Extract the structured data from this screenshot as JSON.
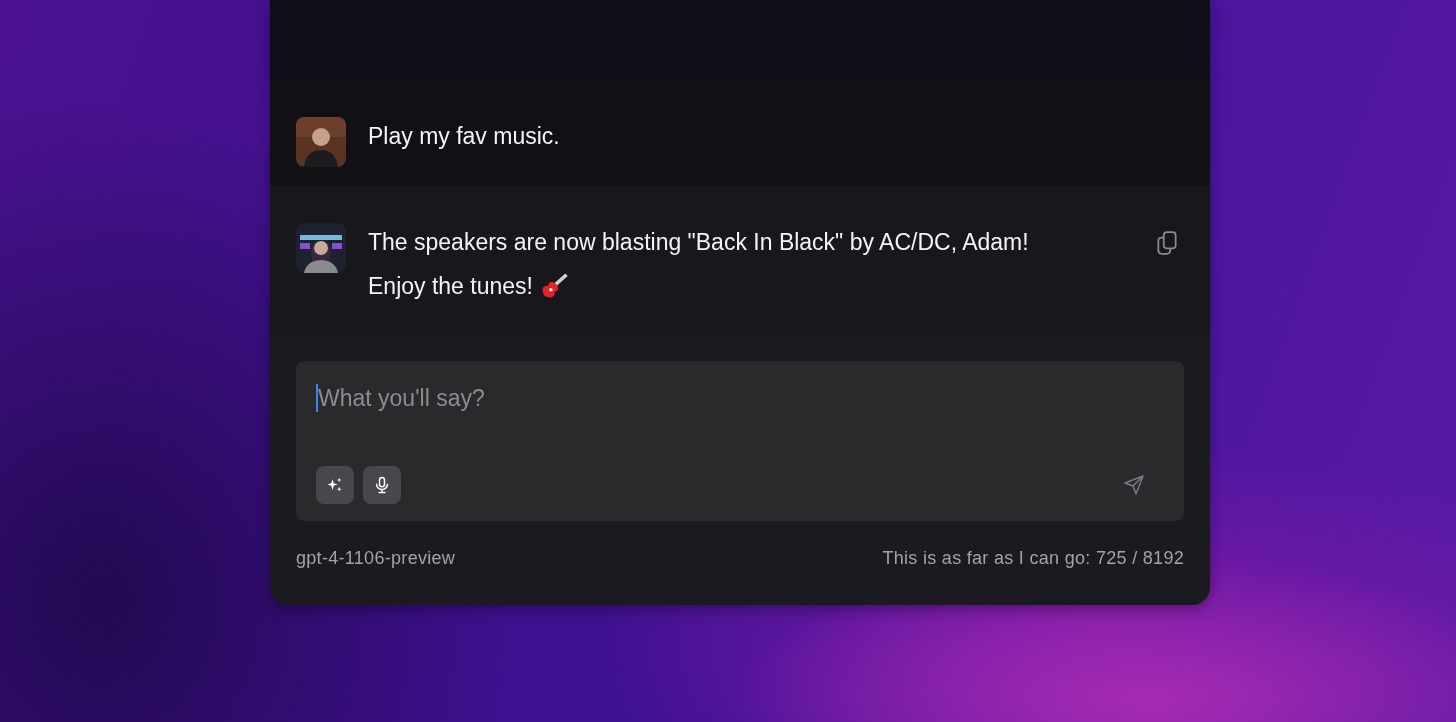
{
  "messages": [
    {
      "kind": "user",
      "text": "Play my fav music.",
      "copy": false
    },
    {
      "kind": "assistant",
      "text": "The speakers are now blasting \"Back In Black\" by AC/DC, Adam!",
      "text_2": "Enjoy the tunes!",
      "copy": true
    }
  ],
  "composer": {
    "placeholder": "What you'll say?",
    "focused": true
  },
  "footer": {
    "model": "gpt-4-1106-preview",
    "limit": "This is as far as I can go: 725 / 8192"
  }
}
